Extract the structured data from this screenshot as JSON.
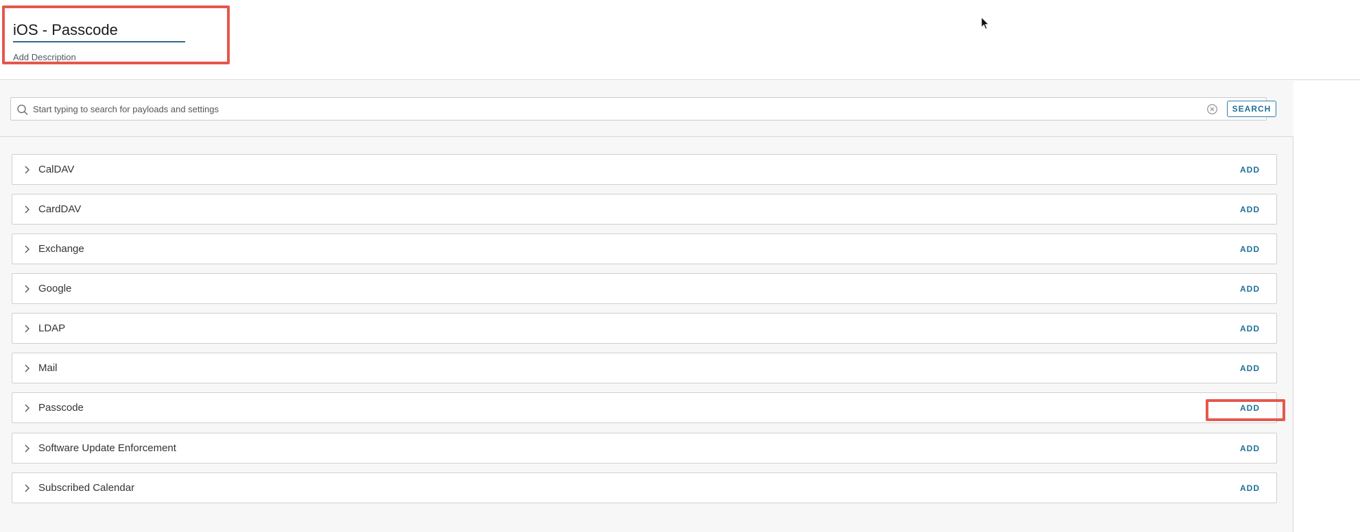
{
  "header": {
    "title_value": "iOS - Passcode",
    "add_description": "Add Description"
  },
  "search": {
    "placeholder": "Start typing to search for payloads and settings",
    "button_label": "SEARCH"
  },
  "payloads": [
    {
      "label": "CalDAV",
      "action": "ADD"
    },
    {
      "label": "CardDAV",
      "action": "ADD"
    },
    {
      "label": "Exchange",
      "action": "ADD"
    },
    {
      "label": "Google",
      "action": "ADD"
    },
    {
      "label": "LDAP",
      "action": "ADD"
    },
    {
      "label": "Mail",
      "action": "ADD"
    },
    {
      "label": "Passcode",
      "action": "ADD"
    },
    {
      "label": "Software Update Enforcement",
      "action": "ADD"
    },
    {
      "label": "Subscribed Calendar",
      "action": "ADD"
    }
  ],
  "icons": {
    "search": "search-icon",
    "clear": "clear-circle-icon",
    "expand": "chevron-right-icon",
    "cursor": "mouse-pointer-icon"
  },
  "colors": {
    "accent": "#1f6f98",
    "highlight": "#e5574c",
    "title_underline": "#2b6c88"
  }
}
